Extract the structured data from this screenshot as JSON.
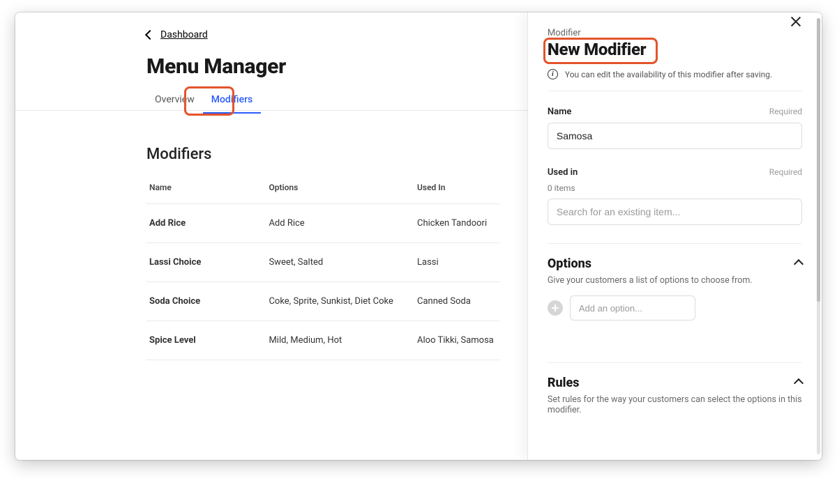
{
  "breadcrumb": {
    "back_label": "Dashboard"
  },
  "page": {
    "title": "Menu Manager"
  },
  "tabs": {
    "overview_label": "Overview",
    "modifiers_label": "Modifiers",
    "active": "modifiers"
  },
  "modifiers": {
    "heading": "Modifiers",
    "columns": {
      "name": "Name",
      "options": "Options",
      "used_in": "Used In"
    },
    "rows": [
      {
        "name": "Add Rice",
        "options": "Add Rice",
        "used_in": "Chicken Tandoori"
      },
      {
        "name": "Lassi Choice",
        "options": "Sweet, Salted",
        "used_in": "Lassi"
      },
      {
        "name": "Soda Choice",
        "options": "Coke, Sprite, Sunkist, Diet Coke",
        "used_in": "Canned Soda"
      },
      {
        "name": "Spice Level",
        "options": "Mild, Medium, Hot",
        "used_in": "Aloo Tikki, Samosa"
      }
    ]
  },
  "panel": {
    "eyebrow": "Modifier",
    "title": "New Modifier",
    "info": "You can edit the availability of this modifier after saving.",
    "name_field": {
      "label": "Name",
      "required": "Required",
      "value": "Samosa"
    },
    "used_in_field": {
      "label": "Used in",
      "required": "Required",
      "count_text": "0 items",
      "search_placeholder": "Search for an existing item..."
    },
    "options_section": {
      "title": "Options",
      "subtitle": "Give your customers a list of options to choose from.",
      "add_placeholder": "Add an option..."
    },
    "rules_section": {
      "title": "Rules",
      "subtitle": "Set rules for the way your customers can select the options in this modifier."
    }
  }
}
